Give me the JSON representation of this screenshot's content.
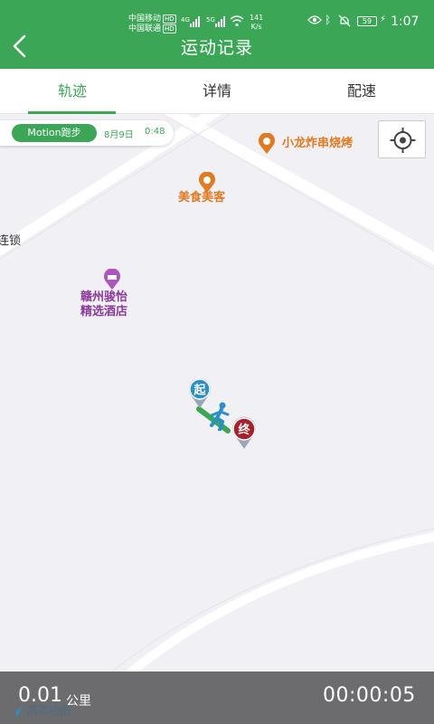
{
  "status_bar": {
    "carrier1": "中国移动",
    "carrier2": "中国联通",
    "hd": "HD",
    "net_type": "4G",
    "net_type2": "5G",
    "speed_value": "141",
    "speed_unit": "K/s",
    "battery": "59",
    "time": "1:07"
  },
  "header": {
    "title": "运动记录"
  },
  "tabs": [
    {
      "label": "轨迹",
      "active": true
    },
    {
      "label": "详情"
    },
    {
      "label": "配速"
    }
  ],
  "map": {
    "motion_tag": "Motion跑步",
    "date": "8月9日",
    "time": "0:48",
    "pois": [
      {
        "name": "小龙炸串烧烤"
      },
      {
        "name": "美食美客"
      },
      {
        "name": "赣州骏怡\n精选酒店"
      },
      {
        "name": "连锁"
      }
    ],
    "start_label": "起",
    "end_label": "终",
    "logo_text": "高德地图"
  },
  "summary": {
    "distance": "0.01",
    "distance_unit": "公里",
    "duration": "00:00:05"
  },
  "colors": {
    "primary": "#3aa656",
    "poi_orange": "#e07b22",
    "poi_purple": "#8b3a9c",
    "bottom_bar": "#6c6c6e"
  }
}
